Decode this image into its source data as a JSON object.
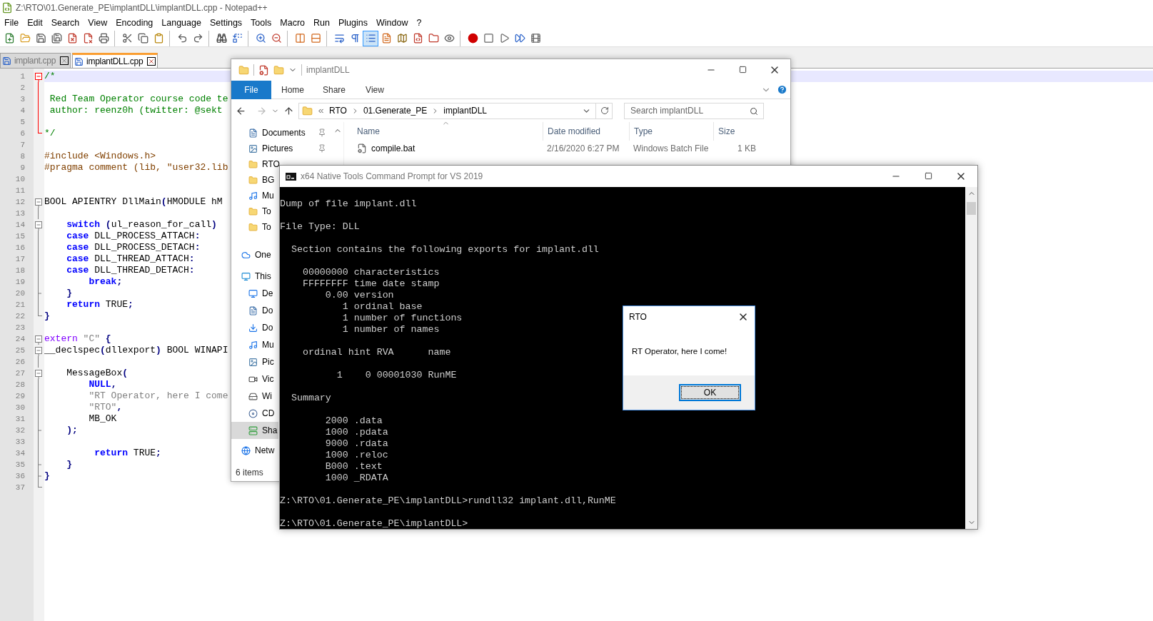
{
  "editor": {
    "title": "Z:\\RTO\\01.Generate_PE\\implantDLL\\implantDLL.cpp - Notepad++",
    "menu": [
      "File",
      "Edit",
      "Search",
      "View",
      "Encoding",
      "Language",
      "Settings",
      "Tools",
      "Macro",
      "Run",
      "Plugins",
      "Window",
      "?"
    ],
    "toolbar_groups": [
      {
        "buttons": [
          {
            "pressed": false
          },
          {
            "pressed": false
          },
          {
            "pressed": false
          },
          {
            "pressed": false
          },
          {
            "pressed": false
          },
          {
            "pressed": false
          },
          {
            "pressed": false
          }
        ]
      },
      {
        "buttons": [
          {
            "pressed": false
          },
          {
            "pressed": false
          },
          {
            "pressed": false
          }
        ]
      },
      {
        "buttons": [
          {
            "pressed": false
          },
          {
            "pressed": false
          }
        ]
      },
      {
        "buttons": [
          {
            "pressed": false
          },
          {
            "pressed": false
          }
        ]
      },
      {
        "buttons": [
          {
            "pressed": false
          },
          {
            "pressed": false
          }
        ]
      },
      {
        "buttons": [
          {
            "pressed": false
          },
          {
            "pressed": false
          }
        ]
      },
      {
        "buttons": [
          {
            "pressed": false
          },
          {
            "pressed": false
          },
          {
            "pressed": true
          },
          {
            "pressed": false
          },
          {
            "pressed": false
          },
          {
            "pressed": false
          },
          {
            "pressed": false
          },
          {
            "pressed": false
          }
        ]
      },
      {
        "buttons": [
          {
            "pressed": false
          },
          {
            "pressed": false
          },
          {
            "pressed": false
          },
          {
            "pressed": false
          },
          {
            "pressed": false
          }
        ]
      }
    ],
    "tabs": [
      {
        "label": "implant.cpp",
        "selected": false
      },
      {
        "label": "implantDLL.cpp",
        "selected": true
      }
    ],
    "lines": [
      {
        "n": "1",
        "fold": {
          "kind": "open",
          "active": true
        },
        "current": true,
        "seg": [
          {
            "kind": "comment",
            "t": "/*"
          }
        ]
      },
      {
        "n": "2",
        "fold": {
          "kind": "line",
          "active": true
        },
        "current": false
      },
      {
        "n": "3",
        "fold": {
          "kind": "line",
          "active": true
        },
        "current": false,
        "seg": [
          {
            "kind": "comment",
            "t": " Red Team Operator course code te"
          }
        ]
      },
      {
        "n": "4",
        "fold": {
          "kind": "line",
          "active": true
        },
        "current": false,
        "seg": [
          {
            "kind": "comment",
            "t": " author: reenz0h (twitter: @sekt"
          }
        ]
      },
      {
        "n": "5",
        "fold": {
          "kind": "line",
          "active": true
        },
        "current": false
      },
      {
        "n": "6",
        "fold": {
          "kind": "end",
          "active": true
        },
        "current": false,
        "seg": [
          {
            "kind": "comment",
            "t": "*/"
          }
        ]
      },
      {
        "n": "7",
        "current": false
      },
      {
        "n": "8",
        "current": false,
        "seg": [
          {
            "kind": "preproc",
            "t": "#include <Windows.h>"
          }
        ]
      },
      {
        "n": "9",
        "current": false,
        "seg": [
          {
            "kind": "preproc",
            "t": "#pragma comment (lib, \"user32.lib"
          }
        ]
      },
      {
        "n": "10",
        "current": false
      },
      {
        "n": "11",
        "current": false
      },
      {
        "n": "12",
        "fold": {
          "kind": "open",
          "active": false
        },
        "current": false,
        "seg": [
          {
            "kind": "plain",
            "t": "BOOL APIENTRY DllMain"
          },
          {
            "kind": "op",
            "t": "("
          },
          {
            "kind": "plain",
            "t": "HMODULE hM"
          }
        ]
      },
      {
        "n": "13",
        "fold": {
          "kind": "line",
          "active": false
        },
        "current": false
      },
      {
        "n": "14",
        "fold": {
          "kind": "open",
          "active": false
        },
        "current": false,
        "seg": [
          {
            "kind": "keyword",
            "t": "    switch"
          },
          {
            "kind": "op",
            "t": " ("
          },
          {
            "kind": "plain",
            "t": "ul_reason_for_call"
          },
          {
            "kind": "op",
            "t": ")"
          }
        ]
      },
      {
        "n": "15",
        "fold": {
          "kind": "line",
          "active": false
        },
        "current": false,
        "seg": [
          {
            "kind": "keyword",
            "t": "    case"
          },
          {
            "kind": "plain",
            "t": " DLL_PROCESS_ATTACH"
          },
          {
            "kind": "op",
            "t": ":"
          }
        ]
      },
      {
        "n": "16",
        "fold": {
          "kind": "line",
          "active": false
        },
        "current": false,
        "seg": [
          {
            "kind": "keyword",
            "t": "    case"
          },
          {
            "kind": "plain",
            "t": " DLL_PROCESS_DETACH"
          },
          {
            "kind": "op",
            "t": ":"
          }
        ]
      },
      {
        "n": "17",
        "fold": {
          "kind": "line",
          "active": false
        },
        "current": false,
        "seg": [
          {
            "kind": "keyword",
            "t": "    case"
          },
          {
            "kind": "plain",
            "t": " DLL_THREAD_ATTACH"
          },
          {
            "kind": "op",
            "t": ":"
          }
        ]
      },
      {
        "n": "18",
        "fold": {
          "kind": "line",
          "active": false
        },
        "current": false,
        "seg": [
          {
            "kind": "keyword",
            "t": "    case"
          },
          {
            "kind": "plain",
            "t": " DLL_THREAD_DETACH"
          },
          {
            "kind": "op",
            "t": ":"
          }
        ]
      },
      {
        "n": "19",
        "fold": {
          "kind": "line",
          "active": false
        },
        "current": false,
        "seg": [
          {
            "kind": "keyword",
            "t": "        break"
          },
          {
            "kind": "op",
            "t": ";"
          }
        ]
      },
      {
        "n": "20",
        "fold": {
          "kind": "branch",
          "active": false
        },
        "current": false,
        "seg": [
          {
            "kind": "op",
            "t": "    }"
          }
        ]
      },
      {
        "n": "21",
        "fold": {
          "kind": "line",
          "active": false
        },
        "current": false,
        "seg": [
          {
            "kind": "keyword",
            "t": "    return"
          },
          {
            "kind": "plain",
            "t": " TRUE"
          },
          {
            "kind": "op",
            "t": ";"
          }
        ]
      },
      {
        "n": "22",
        "fold": {
          "kind": "end",
          "active": false
        },
        "current": false,
        "seg": [
          {
            "kind": "op",
            "t": "}"
          }
        ]
      },
      {
        "n": "23",
        "current": false
      },
      {
        "n": "24",
        "fold": {
          "kind": "open",
          "active": false
        },
        "current": false,
        "seg": [
          {
            "kind": "keyword2",
            "t": "extern"
          },
          {
            "kind": "string",
            "t": " \"C\""
          },
          {
            "kind": "op",
            "t": " {"
          }
        ]
      },
      {
        "n": "25",
        "fold": {
          "kind": "open",
          "active": false
        },
        "current": false,
        "seg": [
          {
            "kind": "plain",
            "t": "__declspec"
          },
          {
            "kind": "op",
            "t": "("
          },
          {
            "kind": "plain",
            "t": "dllexport"
          },
          {
            "kind": "op",
            "t": ")"
          },
          {
            "kind": "plain",
            "t": " BOOL WINAPI"
          }
        ]
      },
      {
        "n": "26",
        "fold": {
          "kind": "line",
          "active": false
        },
        "current": false
      },
      {
        "n": "27",
        "fold": {
          "kind": "open",
          "active": false
        },
        "current": false,
        "seg": [
          {
            "kind": "plain",
            "t": "    MessageBox"
          },
          {
            "kind": "op",
            "t": "("
          }
        ]
      },
      {
        "n": "28",
        "fold": {
          "kind": "line",
          "active": false
        },
        "current": false,
        "seg": [
          {
            "kind": "keyword",
            "t": "        NULL"
          },
          {
            "kind": "op",
            "t": ","
          }
        ]
      },
      {
        "n": "29",
        "fold": {
          "kind": "line",
          "active": false
        },
        "current": false,
        "seg": [
          {
            "kind": "string",
            "t": "        \"RT Operator, here I come"
          }
        ]
      },
      {
        "n": "30",
        "fold": {
          "kind": "line",
          "active": false
        },
        "current": false,
        "seg": [
          {
            "kind": "string",
            "t": "        \"RTO\""
          },
          {
            "kind": "op",
            "t": ","
          }
        ]
      },
      {
        "n": "31",
        "fold": {
          "kind": "line",
          "active": false
        },
        "current": false,
        "seg": [
          {
            "kind": "plain",
            "t": "        MB_OK"
          }
        ]
      },
      {
        "n": "32",
        "fold": {
          "kind": "branch",
          "active": false
        },
        "current": false,
        "seg": [
          {
            "kind": "op",
            "t": "    );"
          }
        ]
      },
      {
        "n": "33",
        "fold": {
          "kind": "line",
          "active": false
        },
        "current": false
      },
      {
        "n": "34",
        "fold": {
          "kind": "line",
          "active": false
        },
        "current": false,
        "seg": [
          {
            "kind": "keyword",
            "t": "         return"
          },
          {
            "kind": "plain",
            "t": " TRUE"
          },
          {
            "kind": "op",
            "t": ";"
          }
        ]
      },
      {
        "n": "35",
        "fold": {
          "kind": "branch",
          "active": false
        },
        "current": false,
        "seg": [
          {
            "kind": "op",
            "t": "    }"
          }
        ]
      },
      {
        "n": "36",
        "fold": {
          "kind": "branch",
          "active": false
        },
        "current": false,
        "seg": [
          {
            "kind": "op",
            "t": "}"
          }
        ]
      },
      {
        "n": "37",
        "fold": {
          "kind": "end",
          "active": false
        },
        "current": false
      }
    ]
  },
  "explorer": {
    "title": "implantDLL",
    "ribbon_tabs": [
      {
        "label": "File",
        "selected": true
      },
      {
        "label": "Home",
        "selected": false
      },
      {
        "label": "Share",
        "selected": false
      },
      {
        "label": "View",
        "selected": false
      }
    ],
    "breadcrumbs": [
      "RTO",
      "01.Generate_PE",
      "implantDLL"
    ],
    "search": {
      "placeholder": "Search implantDLL"
    },
    "sidebar": [
      {
        "kind": "group",
        "children": [
          {
            "label": "Documents",
            "kind": "document",
            "pinned": true,
            "selected": false
          },
          {
            "label": "Pictures",
            "kind": "picture",
            "pinned": true,
            "selected": false
          },
          {
            "label": "RTO",
            "kind": "folder",
            "selected": false
          },
          {
            "label": "BG",
            "kind": "folder",
            "selected": false
          },
          {
            "label": "Mu",
            "kind": "music",
            "selected": false
          },
          {
            "label": "To",
            "kind": "folder",
            "selected": false
          },
          {
            "label": "To",
            "kind": "folder",
            "selected": false
          }
        ]
      },
      {
        "kind": "cloud",
        "label": "One",
        "selected": false
      },
      {
        "kind": "computer",
        "label": "This",
        "selected": false,
        "children": [
          {
            "label": "De",
            "kind": "desktop",
            "selected": false
          },
          {
            "label": "Do",
            "kind": "document",
            "selected": false
          },
          {
            "label": "Do",
            "kind": "download",
            "selected": false
          },
          {
            "label": "Mu",
            "kind": "music",
            "selected": false
          },
          {
            "label": "Pic",
            "kind": "picture",
            "selected": false
          },
          {
            "label": "Vic",
            "kind": "video",
            "selected": false
          },
          {
            "label": "Wi",
            "kind": "drive",
            "selected": false
          },
          {
            "label": "CD",
            "kind": "disc",
            "selected": false
          },
          {
            "label": "Sha",
            "kind": "network-drive",
            "selected": true
          }
        ]
      },
      {
        "kind": "network",
        "label": "Netw",
        "selected": false
      }
    ],
    "columns": [
      "Name",
      "Date modified",
      "Type",
      "Size"
    ],
    "files": [
      {
        "name": "compile.bat",
        "date": "2/16/2020 6:27 PM",
        "type": "Windows Batch File",
        "size": "1 KB"
      }
    ],
    "status": "6 items"
  },
  "console": {
    "title": "x64 Native Tools Command Prompt for VS 2019",
    "blocks": [
      [
        "Dump of file implant.dll"
      ],
      [
        "File Type: DLL"
      ],
      [
        "  Section contains the following exports for implant.dll"
      ],
      [
        "    00000000 characteristics",
        "    FFFFFFFF time date stamp",
        "        0.00 version",
        "           1 ordinal base",
        "           1 number of functions",
        "           1 number of names"
      ],
      [
        "    ordinal hint RVA      name"
      ],
      [
        "          1    0 00001030 RunME"
      ],
      [
        "  Summary"
      ],
      [
        "        2000 .data",
        "        1000 .pdata",
        "        9000 .rdata",
        "        1000 .reloc",
        "        B000 .text",
        "        1000 _RDATA"
      ],
      [
        "Z:\\RTO\\01.Generate_PE\\implantDLL>rundll32 implant.dll,RunME"
      ],
      [
        "Z:\\RTO\\01.Generate_PE\\implantDLL>"
      ]
    ]
  },
  "message_box": {
    "title": "RTO",
    "message": "RT Operator, here I come!",
    "button": "OK"
  }
}
